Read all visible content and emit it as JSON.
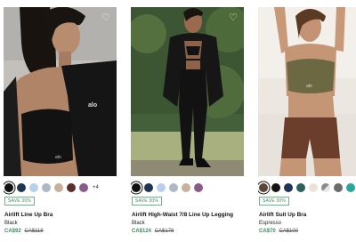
{
  "products": [
    {
      "badge": "SAVE 30%",
      "name": "Airlift Line Up Bra",
      "color": "Black",
      "sale_price": "CA$92",
      "original_price": "CA$118",
      "more_colors": "+4",
      "swatches": [
        "#111111",
        "#1f3554",
        "#b8d0ec",
        "#aeb8c4",
        "#c8b09a",
        "#5a2e2a",
        "#8a5a8c"
      ]
    },
    {
      "badge": "SAVE 30%",
      "name": "Airlift High-Waist 7/8 Line Up Legging",
      "color": "Black",
      "sale_price": "CA$124",
      "original_price": "CA$178",
      "swatches": [
        "#111111",
        "#1f3554",
        "#b8d0ec",
        "#aeb8c4",
        "#c8b09a",
        "#8a5a8c"
      ]
    },
    {
      "badge": "SAVE 30%",
      "name": "Airlift Suit Up Bra",
      "color": "Espresso",
      "sale_price": "CA$70",
      "original_price": "CA$100",
      "swatches": [
        "#5e4535",
        "#141414",
        "#1f3554",
        "#2f5f5a",
        "#ece3d6",
        "split",
        "#6c6c6c",
        "#2aa79b"
      ]
    }
  ]
}
